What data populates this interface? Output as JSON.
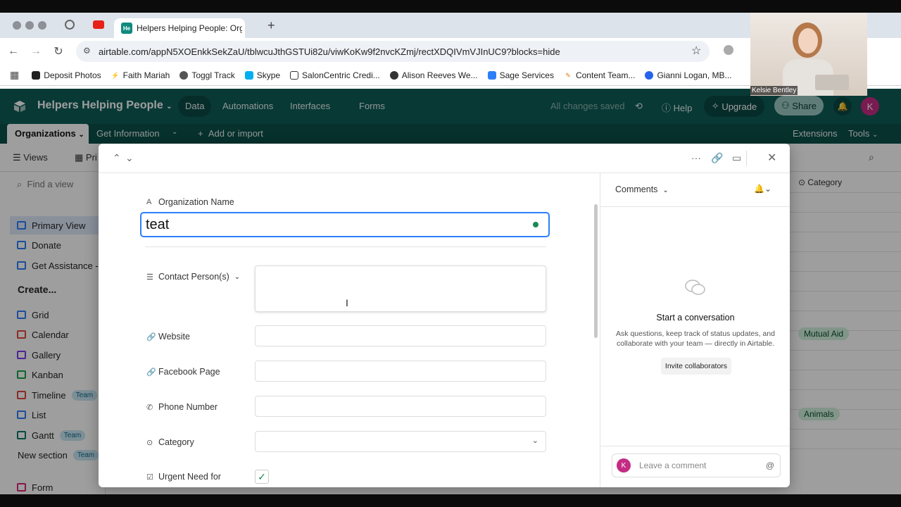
{
  "browser": {
    "tabs": [
      {
        "label": "Helpers Helping People: Orga",
        "icon": "airtable-favicon"
      }
    ],
    "url": "airtable.com/appN5XOEnkkSekZaU/tblwcuJthGSTUi82u/viwKoKw9f2nvcKZmj/rectXDQIVmVJInUC9?blocks=hide",
    "bookmarks": [
      "Deposit Photos",
      "Faith Mariah",
      "Toggl Track",
      "Skype",
      "SalonCentric Credi...",
      "Alison Reeves We...",
      "Sage Services",
      "Content Team...",
      "Gianni Logan, MB..."
    ]
  },
  "webcam": {
    "name": "Kelsie Bentley"
  },
  "app": {
    "base_name": "Helpers Helping People",
    "nav": [
      "Data",
      "Automations",
      "Interfaces",
      "Forms"
    ],
    "status": "All changes saved",
    "help": "Help",
    "upgrade": "Upgrade",
    "share": "Share",
    "avatar_initial": "K"
  },
  "tablebar": {
    "active_table": "Organizations",
    "other_table": "Get Information",
    "add": "Add or import",
    "extensions": "Extensions",
    "tools": "Tools"
  },
  "viewbar": {
    "views_label": "Views",
    "view_partial": "Pri"
  },
  "sidebar": {
    "find_placeholder": "Find a view",
    "views": [
      "Primary View",
      "Donate",
      "Get Assistance - C"
    ],
    "create_label": "Create...",
    "create_items": [
      {
        "label": "Grid",
        "badge": ""
      },
      {
        "label": "Calendar",
        "badge": ""
      },
      {
        "label": "Gallery",
        "badge": ""
      },
      {
        "label": "Kanban",
        "badge": ""
      },
      {
        "label": "Timeline",
        "badge": "Team"
      },
      {
        "label": "List",
        "badge": ""
      },
      {
        "label": "Gantt",
        "badge": "Team"
      }
    ],
    "new_section": "New section",
    "new_section_badge": "Team",
    "form": "Form"
  },
  "grid": {
    "column": "Category",
    "pills": [
      {
        "label": "Mutual Aid",
        "color": "#d1f0dd"
      },
      {
        "label": "Animals",
        "color": "#d1f0dd"
      }
    ]
  },
  "record": {
    "fields": {
      "org_name_label": "Organization Name",
      "org_name_value": "teat",
      "contact_label": "Contact Person(s)",
      "website_label": "Website",
      "facebook_label": "Facebook Page",
      "phone_label": "Phone Number",
      "category_label": "Category",
      "urgent_label": "Urgent Need for"
    }
  },
  "comments": {
    "header": "Comments",
    "title": "Start a conversation",
    "body": "Ask questions, keep track of status updates, and collaborate with your team — directly in Airtable.",
    "invite": "Invite collaborators",
    "placeholder": "Leave a comment",
    "avatar_initial": "K"
  },
  "colors": {
    "header": "#0e5c56",
    "accent": "#2d7ff9",
    "avatar": "#c42c84"
  }
}
